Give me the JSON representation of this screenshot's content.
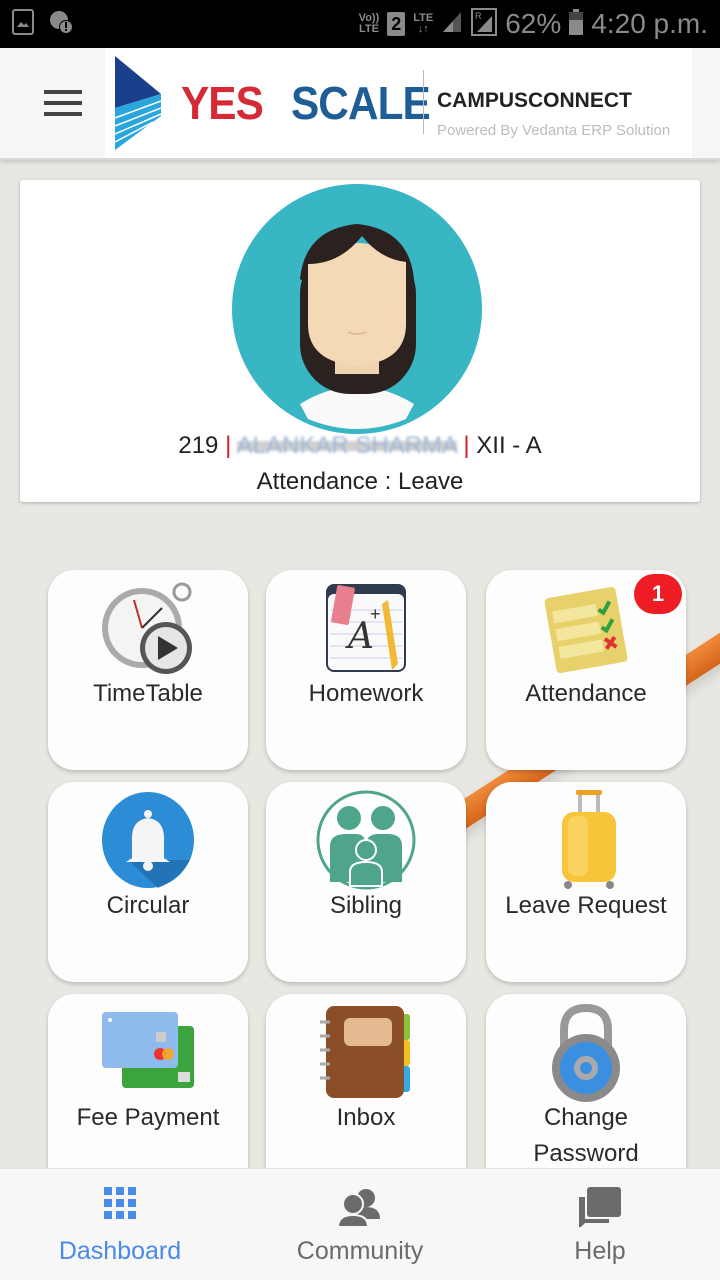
{
  "status_bar": {
    "icons_left": [
      "gallery-icon",
      "sync-alert-icon"
    ],
    "volte": [
      "Vo))",
      "LTE"
    ],
    "sim_slot": "2",
    "network": "LTE",
    "battery_percent": "62%",
    "battery_level": 0.62,
    "time": "4:20 p.m."
  },
  "app_bar": {
    "brand_yes": "YES",
    "brand_scale": "SCALE",
    "product": "CAMPUSCONNECT",
    "powered_by": "Powered By Vedanta ERP Solution"
  },
  "profile": {
    "roll_no": "219",
    "separator": "|",
    "student_name": "ALANKAR SHARMA",
    "class_section": "XII - A",
    "attendance_line": "Attendance : Leave"
  },
  "tiles": [
    {
      "label": "TimeTable",
      "icon": "stopwatch-icon"
    },
    {
      "label": "Homework",
      "icon": "notepad-icon"
    },
    {
      "label": "Attendance",
      "icon": "checklist-icon",
      "badge": "1"
    },
    {
      "label": "Circular",
      "icon": "bell-icon"
    },
    {
      "label": "Sibling",
      "icon": "family-icon"
    },
    {
      "label": "Leave Request",
      "icon": "suitcase-icon"
    },
    {
      "label": "Fee Payment",
      "icon": "credit-cards-icon"
    },
    {
      "label": "Inbox",
      "icon": "notebook-icon"
    },
    {
      "label": "Change Password",
      "icon": "padlock-icon"
    }
  ],
  "bottom_nav": {
    "items": [
      {
        "label": "Dashboard",
        "icon": "grid-icon",
        "active": true
      },
      {
        "label": "Community",
        "icon": "people-icon",
        "active": false
      },
      {
        "label": "Help",
        "icon": "chat-icon",
        "active": false
      }
    ]
  },
  "colors": {
    "accent": "#4a8ae8",
    "badge": "#ee1c25",
    "brand_red": "#d42a35",
    "brand_blue": "#1e5d95",
    "avatar_bg": "#38b6c4"
  }
}
